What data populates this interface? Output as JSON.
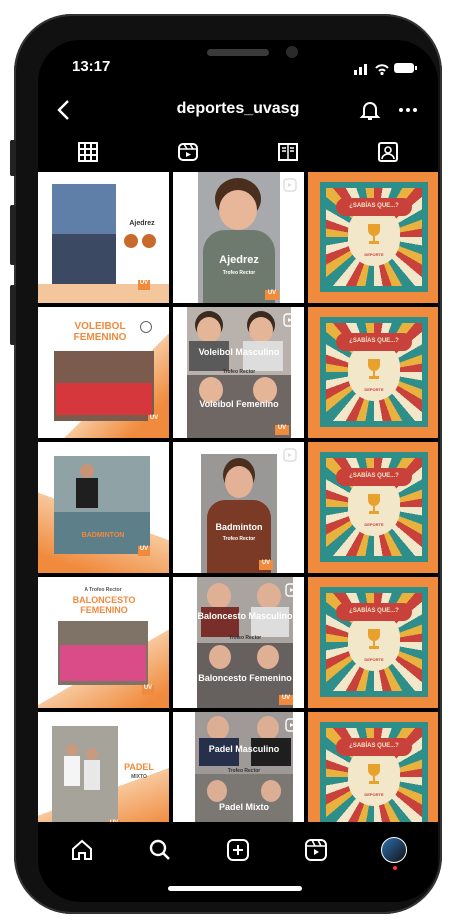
{
  "status": {
    "time": "13:17"
  },
  "header": {
    "username": "deportes_uvasg"
  },
  "tabs": [
    "grid",
    "reels",
    "guides",
    "tagged"
  ],
  "posts": [
    {
      "title": "Ajedrez",
      "subtitle": "",
      "badge": "UV"
    },
    {
      "title": "Ajedrez",
      "subtitle": "Trofeo Rector",
      "badge": "UV"
    },
    {
      "title": "¿SABÍAS QUE...?",
      "subtitle": "DEPORTE",
      "badge": ""
    },
    {
      "title": "VOLEIBOL FEMENINO",
      "subtitle": "",
      "badge": "UV"
    },
    {
      "title": "Voleibol Masculino",
      "subtitle": "Trofeo Rector",
      "title2": "Voleibol Femenino",
      "badge": "UV"
    },
    {
      "title": "¿SABÍAS QUE...?",
      "subtitle": "DEPORTE",
      "badge": ""
    },
    {
      "title": "BADMINTON",
      "subtitle": "",
      "badge": "UV"
    },
    {
      "title": "Badminton",
      "subtitle": "Trofeo Rector",
      "badge": "UV"
    },
    {
      "title": "¿SABÍAS QUE...?",
      "subtitle": "DEPORTE",
      "badge": ""
    },
    {
      "title": "BALONCESTO FEMENINO",
      "subtitle": "A Trofeo Rector",
      "badge": "UV"
    },
    {
      "title": "Baloncesto Masculino",
      "subtitle": "Trofeo Rector",
      "title2": "Baloncesto Femenino",
      "badge": "UV"
    },
    {
      "title": "¿SABÍAS QUE...?",
      "subtitle": "DEPORTE",
      "badge": ""
    },
    {
      "title": "PADEL",
      "subtitle": "MIXTO",
      "badge": "UV"
    },
    {
      "title": "Padel Masculino",
      "subtitle": "Trofeo Rector",
      "title2": "Padel Mixto",
      "badge": "UV"
    },
    {
      "title": "¿SABÍAS QUE...?",
      "subtitle": "DEPORTE",
      "badge": ""
    }
  ],
  "bottom_nav": [
    "home",
    "search",
    "create",
    "reels",
    "profile"
  ],
  "colors": {
    "accent": "#f08a3c",
    "card_red": "#c8413a",
    "card_cream": "#f3e7c9",
    "bg": "#000000"
  }
}
